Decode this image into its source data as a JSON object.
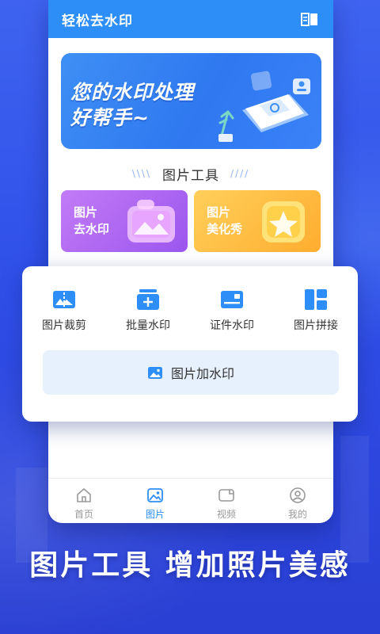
{
  "app": {
    "title": "轻松去水印"
  },
  "banner": {
    "line1": "您的水印处理",
    "line2": "好帮手~"
  },
  "section": {
    "title": "图片工具"
  },
  "cards": [
    {
      "line1": "图片",
      "line2": "去水印"
    },
    {
      "line1": "图片",
      "line2": "美化秀"
    }
  ],
  "popup": {
    "items": [
      {
        "label": "图片裁剪",
        "icon": "crop-image-icon"
      },
      {
        "label": "批量水印",
        "icon": "batch-watermark-icon"
      },
      {
        "label": "证件水印",
        "icon": "id-card-watermark-icon"
      },
      {
        "label": "图片拼接",
        "icon": "image-collage-icon"
      }
    ],
    "add_watermark": "图片加水印"
  },
  "tabs": [
    {
      "label": "首页",
      "icon": "home-icon",
      "active": false
    },
    {
      "label": "图片",
      "icon": "image-icon",
      "active": true
    },
    {
      "label": "视频",
      "icon": "video-icon",
      "active": false
    },
    {
      "label": "我的",
      "icon": "profile-icon",
      "active": false
    }
  ],
  "slogan": "图片工具 增加照片美感",
  "colors": {
    "primary": "#2d8ef7",
    "background": "#3050e8",
    "card_purple": "#a85cf0",
    "card_orange": "#ffb838",
    "button_bg": "#e6f1fd"
  }
}
